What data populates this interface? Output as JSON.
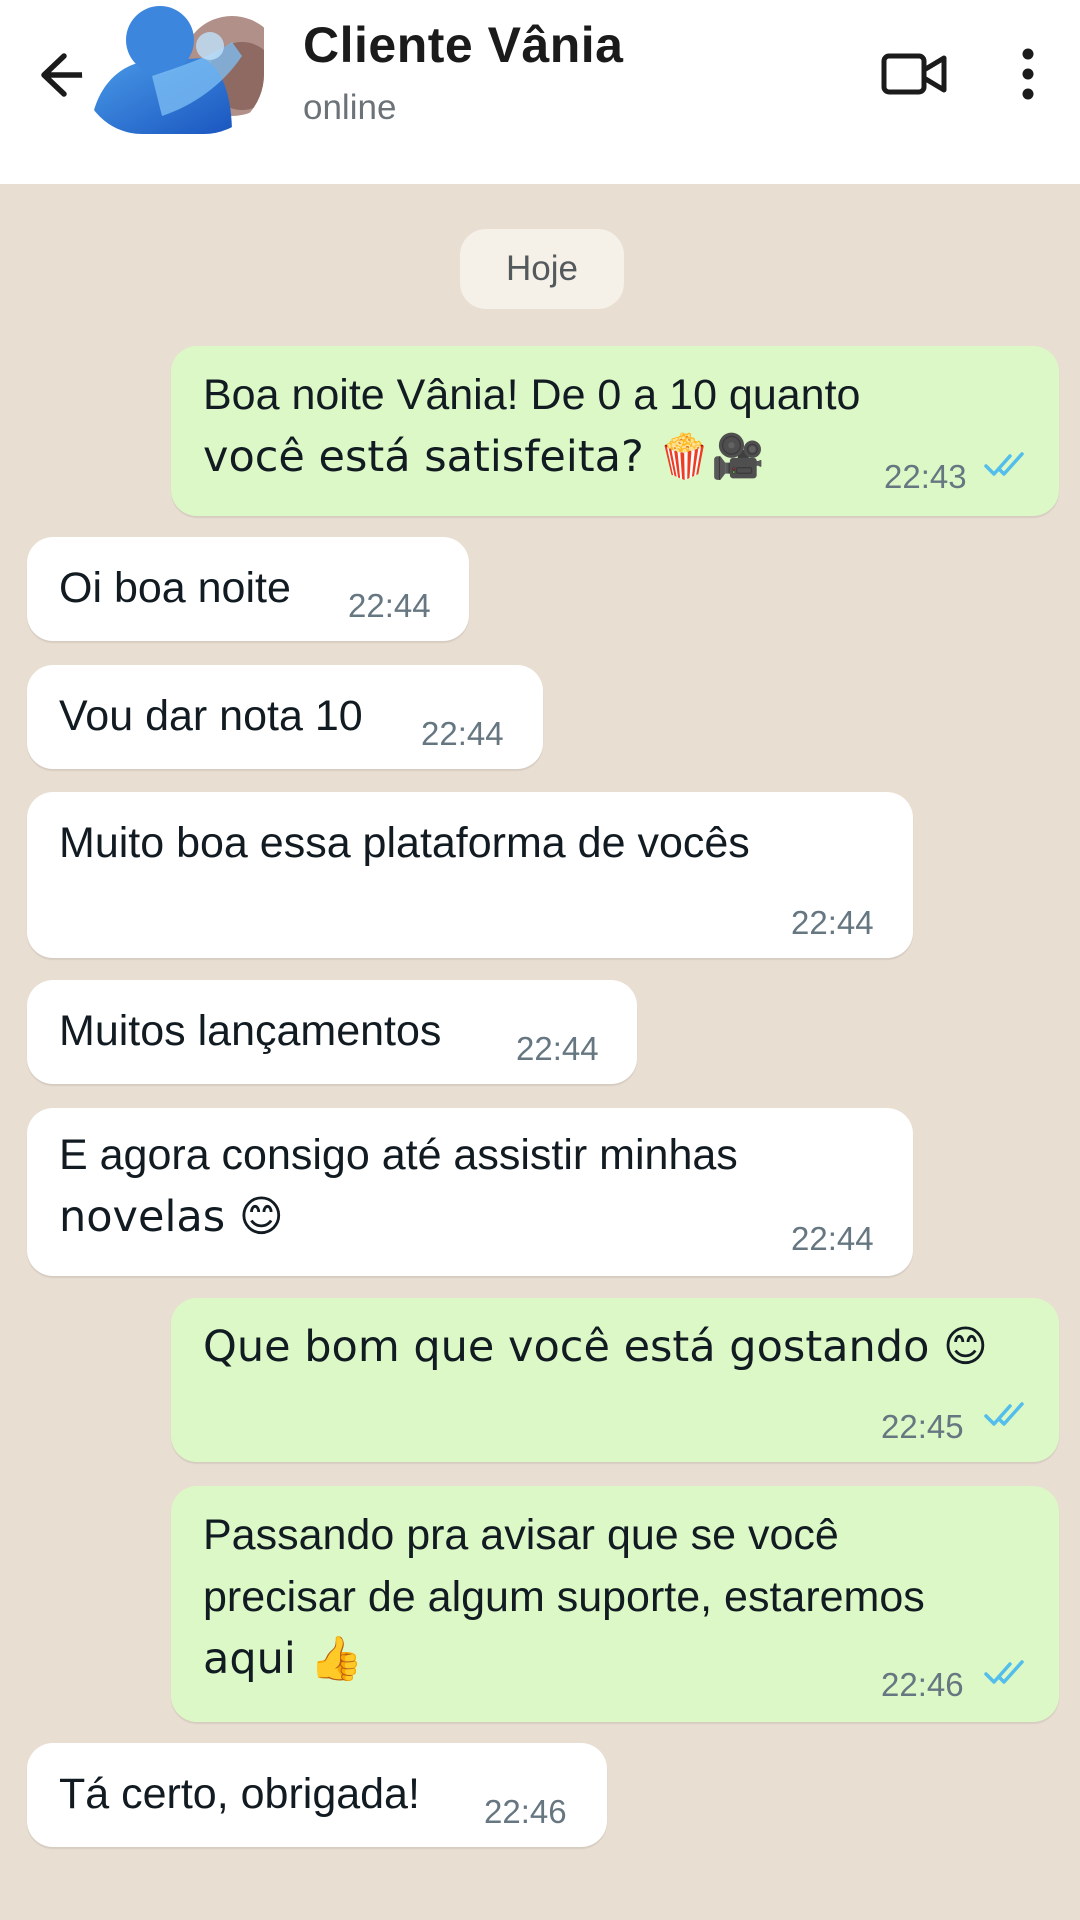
{
  "header": {
    "contact_name": "Cliente Vânia",
    "status": "online",
    "icons": {
      "back": "arrow-left-icon",
      "video": "video-camera-icon",
      "menu": "more-vertical-icon"
    }
  },
  "chat": {
    "date_label": "Hoje",
    "messages": [
      {
        "direction": "outgoing",
        "line1": "Boa noite Vânia! De 0 a 10 quanto",
        "line2": "você está satisfeita? 🍿🎥",
        "time": "22:43",
        "read": true
      },
      {
        "direction": "incoming",
        "line1": "Oi boa noite",
        "time": "22:44"
      },
      {
        "direction": "incoming",
        "line1": "Vou dar nota 10",
        "time": "22:44"
      },
      {
        "direction": "incoming",
        "line1": "Muito boa essa plataforma de vocês",
        "time": "22:44"
      },
      {
        "direction": "incoming",
        "line1": "Muitos lançamentos",
        "time": "22:44"
      },
      {
        "direction": "incoming",
        "line1": "E agora consigo até assistir minhas",
        "line2": "novelas 😊",
        "time": "22:44"
      },
      {
        "direction": "outgoing",
        "line1": "Que bom que você está gostando 😊",
        "time": "22:45",
        "read": true
      },
      {
        "direction": "outgoing",
        "line1": "Passando pra avisar que se você",
        "line2": "precisar de algum suporte, estaremos",
        "line3": "aqui 👍",
        "time": "22:46",
        "read": true
      },
      {
        "direction": "incoming",
        "line1": "Tá certo, obrigada!",
        "time": "22:46"
      }
    ]
  },
  "colors": {
    "chat_background": "#e9ded2",
    "outgoing_bubble": "#dcf8c6",
    "incoming_bubble": "#ffffff",
    "read_ticks": "#53bdeb"
  }
}
